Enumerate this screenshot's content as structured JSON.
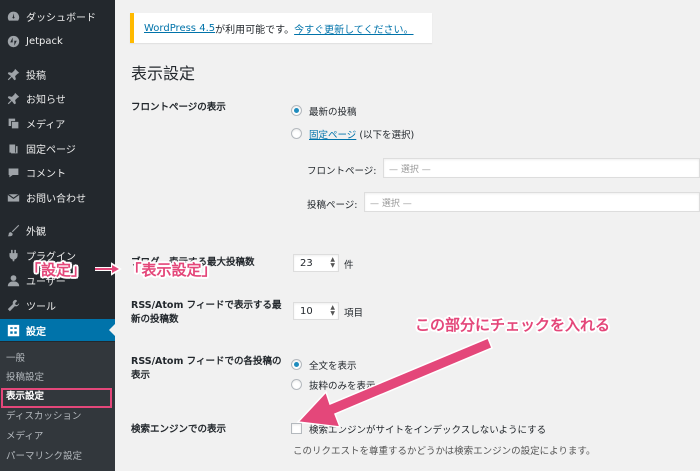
{
  "sidebar": {
    "items": [
      {
        "label": "ダッシュボード",
        "icon": "dashboard-icon"
      },
      {
        "label": "Jetpack",
        "icon": "jetpack-icon"
      },
      {
        "label": "投稿",
        "icon": "pin-icon"
      },
      {
        "label": "お知らせ",
        "icon": "pin-icon"
      },
      {
        "label": "メディア",
        "icon": "media-icon"
      },
      {
        "label": "固定ページ",
        "icon": "page-icon"
      },
      {
        "label": "コメント",
        "icon": "comment-icon"
      },
      {
        "label": "お問い合わせ",
        "icon": "mail-icon"
      },
      {
        "label": "外観",
        "icon": "brush-icon"
      },
      {
        "label": "プラグイン",
        "icon": "plugin-icon"
      },
      {
        "label": "ユーザー",
        "icon": "user-icon"
      },
      {
        "label": "ツール",
        "icon": "wrench-icon"
      },
      {
        "label": "設定",
        "icon": "settings-icon"
      }
    ],
    "submenu": [
      "一般",
      "投稿設定",
      "表示設定",
      "ディスカッション",
      "メディア",
      "パーマリンク設定"
    ]
  },
  "notice": {
    "version_link": "WordPress 4.5",
    "text": " が利用可能です。",
    "update_link": "今すぐ更新してください。"
  },
  "page_title": "表示設定",
  "front_page": {
    "label": "フロントページの表示",
    "option_posts": "最新の投稿",
    "option_static_link": "固定ページ",
    "option_static_suffix": " (以下を選択)",
    "front_label": "フロントページ:",
    "front_value": "— 選択 —",
    "posts_label": "投稿ページ:",
    "posts_value": "— 選択 —"
  },
  "posts_per_page": {
    "label": "ブログ　表示する最大投稿数",
    "value": "23",
    "unit": "件"
  },
  "rss_count": {
    "label": "RSS/Atom フィードで表示する最新の投稿数",
    "value": "10",
    "unit": "項目"
  },
  "rss_display": {
    "label": "RSS/Atom フィードでの各投稿の表示",
    "option_full": "全文を表示",
    "option_summary": "抜粋のみを表示"
  },
  "search_engine": {
    "label": "検索エンジンでの表示",
    "checkbox_label": "検索エンジンがサイトをインデックスしないようにする",
    "description": "このリクエストを尊重するかどうかは検索エンジンの設定によります。"
  },
  "annotations": {
    "left": "「設定」",
    "right": "「表示設定」",
    "check": "この部分にチェックを入れる",
    "color": "#e4477a"
  }
}
